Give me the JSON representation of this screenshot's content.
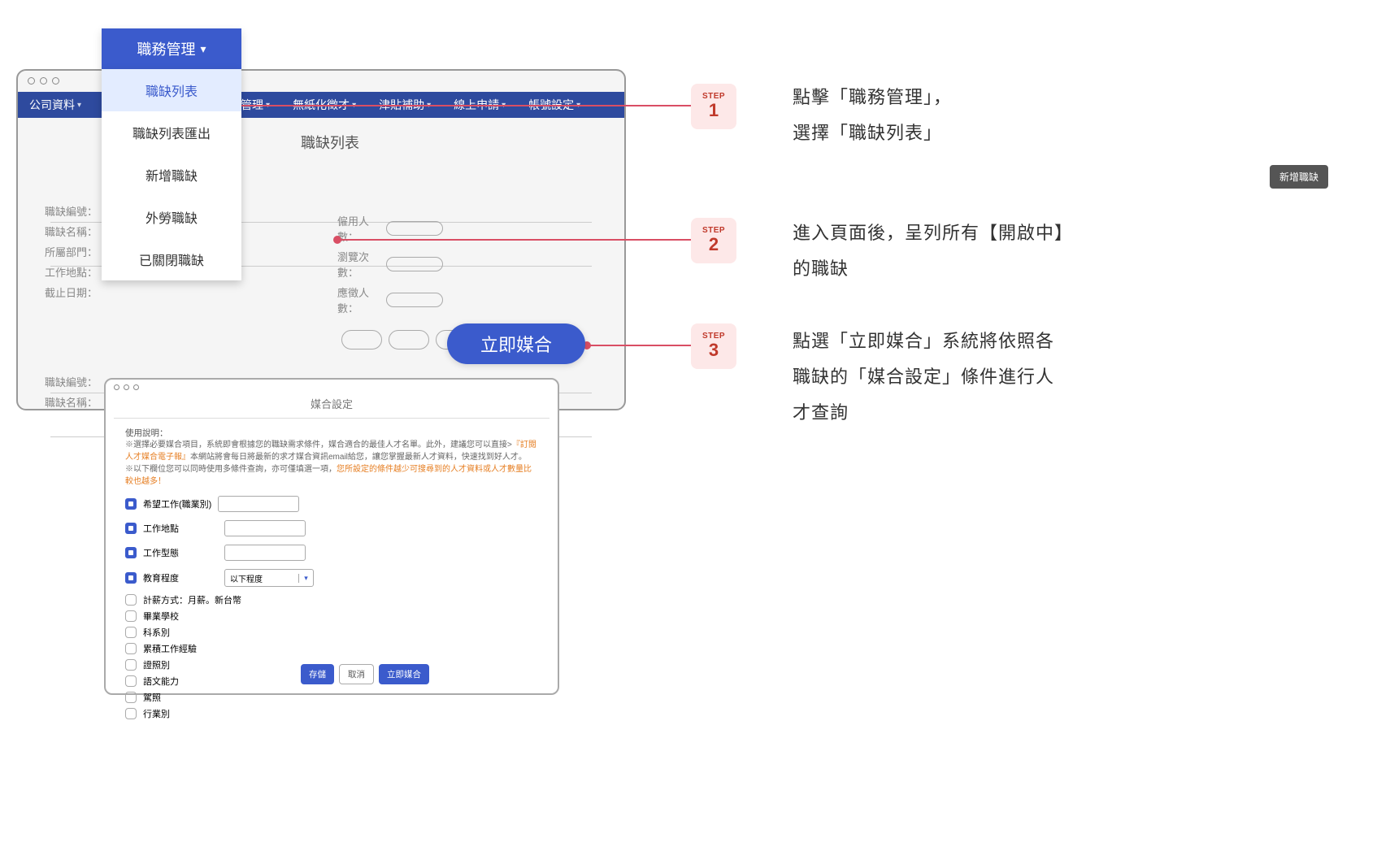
{
  "nav": {
    "items": [
      "公司資料",
      "人才管理",
      "無紙化徵才",
      "津貼補助",
      "線上申請",
      "帳號設定"
    ]
  },
  "dropdown": {
    "header": "職務管理",
    "items": [
      "職缺列表",
      "職缺列表匯出",
      "新增職缺",
      "外勞職缺",
      "已關閉職缺"
    ]
  },
  "page": {
    "title": "職缺列表",
    "add_button": "新增職缺"
  },
  "form": {
    "left_labels": [
      "職缺編號：",
      "職缺名稱：",
      "所屬部門：",
      "工作地點：",
      "截止日期："
    ],
    "right_labels": [
      "僱用人數：",
      "瀏覽次數：",
      "應徵人數："
    ],
    "bottom_labels": [
      "職缺編號：",
      "職缺名稱："
    ]
  },
  "cta": {
    "match": "立即媒合"
  },
  "modal": {
    "title": "媒合設定",
    "instr_title": "使用說明：",
    "instr_1": "※選擇必要媒合項目，系統即會根據您的職缺需求條件，媒合適合的最佳人才名單。此外，建議您可以直接>",
    "instr_1_link": "『訂閱人才媒合電子報』",
    "instr_1_b": "本網站將會每日將最新的求才媒合資訊email給您，讓您掌握最新人才資料，快速找到好人才。",
    "instr_2a": "※以下欄位您可以同時使用多條件查詢，亦可僅填選一項，",
    "instr_2_link": "您所設定的條件越少可搜尋到的人才資料或人才數量比較也越多！",
    "fields": {
      "job_type": "希望工作(職業別)",
      "location": "工作地點",
      "work_type": "工作型態",
      "education": "教育程度",
      "education_select": "以下程度"
    },
    "checkboxes": [
      "計薪方式：月薪。新台幣",
      "畢業學校",
      "科系別",
      "累積工作經驗",
      "證照別",
      "語文能力",
      "駕照",
      "行業別"
    ],
    "buttons": {
      "save": "存儲",
      "cancel": "取消",
      "match": "立即媒合"
    }
  },
  "steps": {
    "label": "STEP",
    "texts": {
      "s1": "點擊「職務管理」，\n選擇「職缺列表」",
      "s2": "進入頁面後，呈列所有【開啟中】\n的職缺",
      "s3": "點選「立即媒合」系統將依照各\n職缺的「媒合設定」條件進行人\n才查詢"
    }
  }
}
